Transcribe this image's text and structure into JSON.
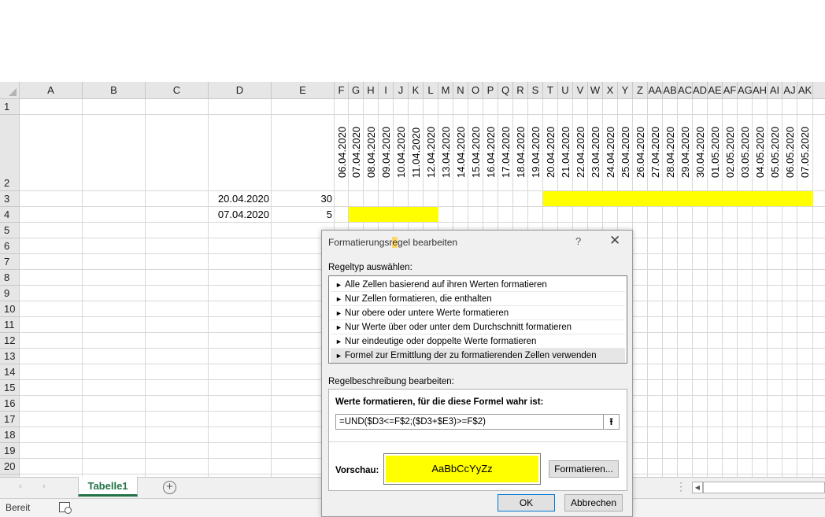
{
  "sheet": {
    "columns": [
      "A",
      "B",
      "C",
      "D",
      "E",
      "F",
      "G",
      "H",
      "I",
      "J",
      "K",
      "L",
      "M",
      "N",
      "O",
      "P",
      "Q",
      "R",
      "S",
      "T",
      "U",
      "V",
      "W",
      "X",
      "Y",
      "Z",
      "AA",
      "AB",
      "AC",
      "AD",
      "AE",
      "AF",
      "AG",
      "AH",
      "AI",
      "AJ",
      "AK"
    ],
    "rows": [
      "1",
      "2",
      "3",
      "4",
      "5",
      "6",
      "7",
      "8",
      "9",
      "10",
      "11",
      "12",
      "13",
      "14",
      "15",
      "16",
      "17",
      "18",
      "19",
      "20"
    ],
    "dates": [
      "06.04.2020",
      "07.04.2020",
      "08.04.2020",
      "09.04.2020",
      "10.04.2020",
      "11.04.2020",
      "12.04.2020",
      "13.04.2020",
      "14.04.2020",
      "15.04.2020",
      "16.04.2020",
      "17.04.2020",
      "18.04.2020",
      "19.04.2020",
      "20.04.2020",
      "21.04.2020",
      "22.04.2020",
      "23.04.2020",
      "24.04.2020",
      "25.04.2020",
      "26.04.2020",
      "27.04.2020",
      "28.04.2020",
      "29.04.2020",
      "30.04.2020",
      "01.05.2020",
      "02.05.2020",
      "03.05.2020",
      "04.05.2020",
      "05.05.2020",
      "06.05.2020",
      "07.05.2020"
    ],
    "row3": {
      "d": "20.04.2020",
      "e": "30"
    },
    "row4": {
      "d": "07.04.2020",
      "e": "5"
    },
    "highlight_color": "#ffff00"
  },
  "tabs": {
    "active_sheet": "Tabelle1",
    "prev_icon": "‹",
    "next_icon": "›",
    "add_icon": "+"
  },
  "status": {
    "ready": "Bereit"
  },
  "dialog": {
    "title_before": "Formatierungsr",
    "title_hot": "e",
    "title_after": "gel bearbeiten",
    "help": "?",
    "close": "✕",
    "rule_type_label": "Regeltyp auswählen:",
    "rule_types": [
      "Alle Zellen basierend auf ihren Werten formatieren",
      "Nur Zellen formatieren, die enthalten",
      "Nur obere oder untere Werte formatieren",
      "Nur Werte über oder unter dem Durchschnitt formatieren",
      "Nur eindeutige oder doppelte Werte formatieren",
      "Formel zur Ermittlung der zu formatierenden Zellen verwenden"
    ],
    "selected_rule_index": 5,
    "rule_desc_label": "Regelbeschreibung bearbeiten:",
    "formula_label": "Werte formatieren, für die diese Formel wahr ist:",
    "formula_value": "=UND($D3<=F$2;($D3+$E3)>=F$2)",
    "collapse_icon": "⭱",
    "preview_label": "Vorschau:",
    "preview_text": "AaBbCcYyZz",
    "format_button": "Formatieren...",
    "ok_button": "OK",
    "cancel_button": "Abbrechen"
  }
}
